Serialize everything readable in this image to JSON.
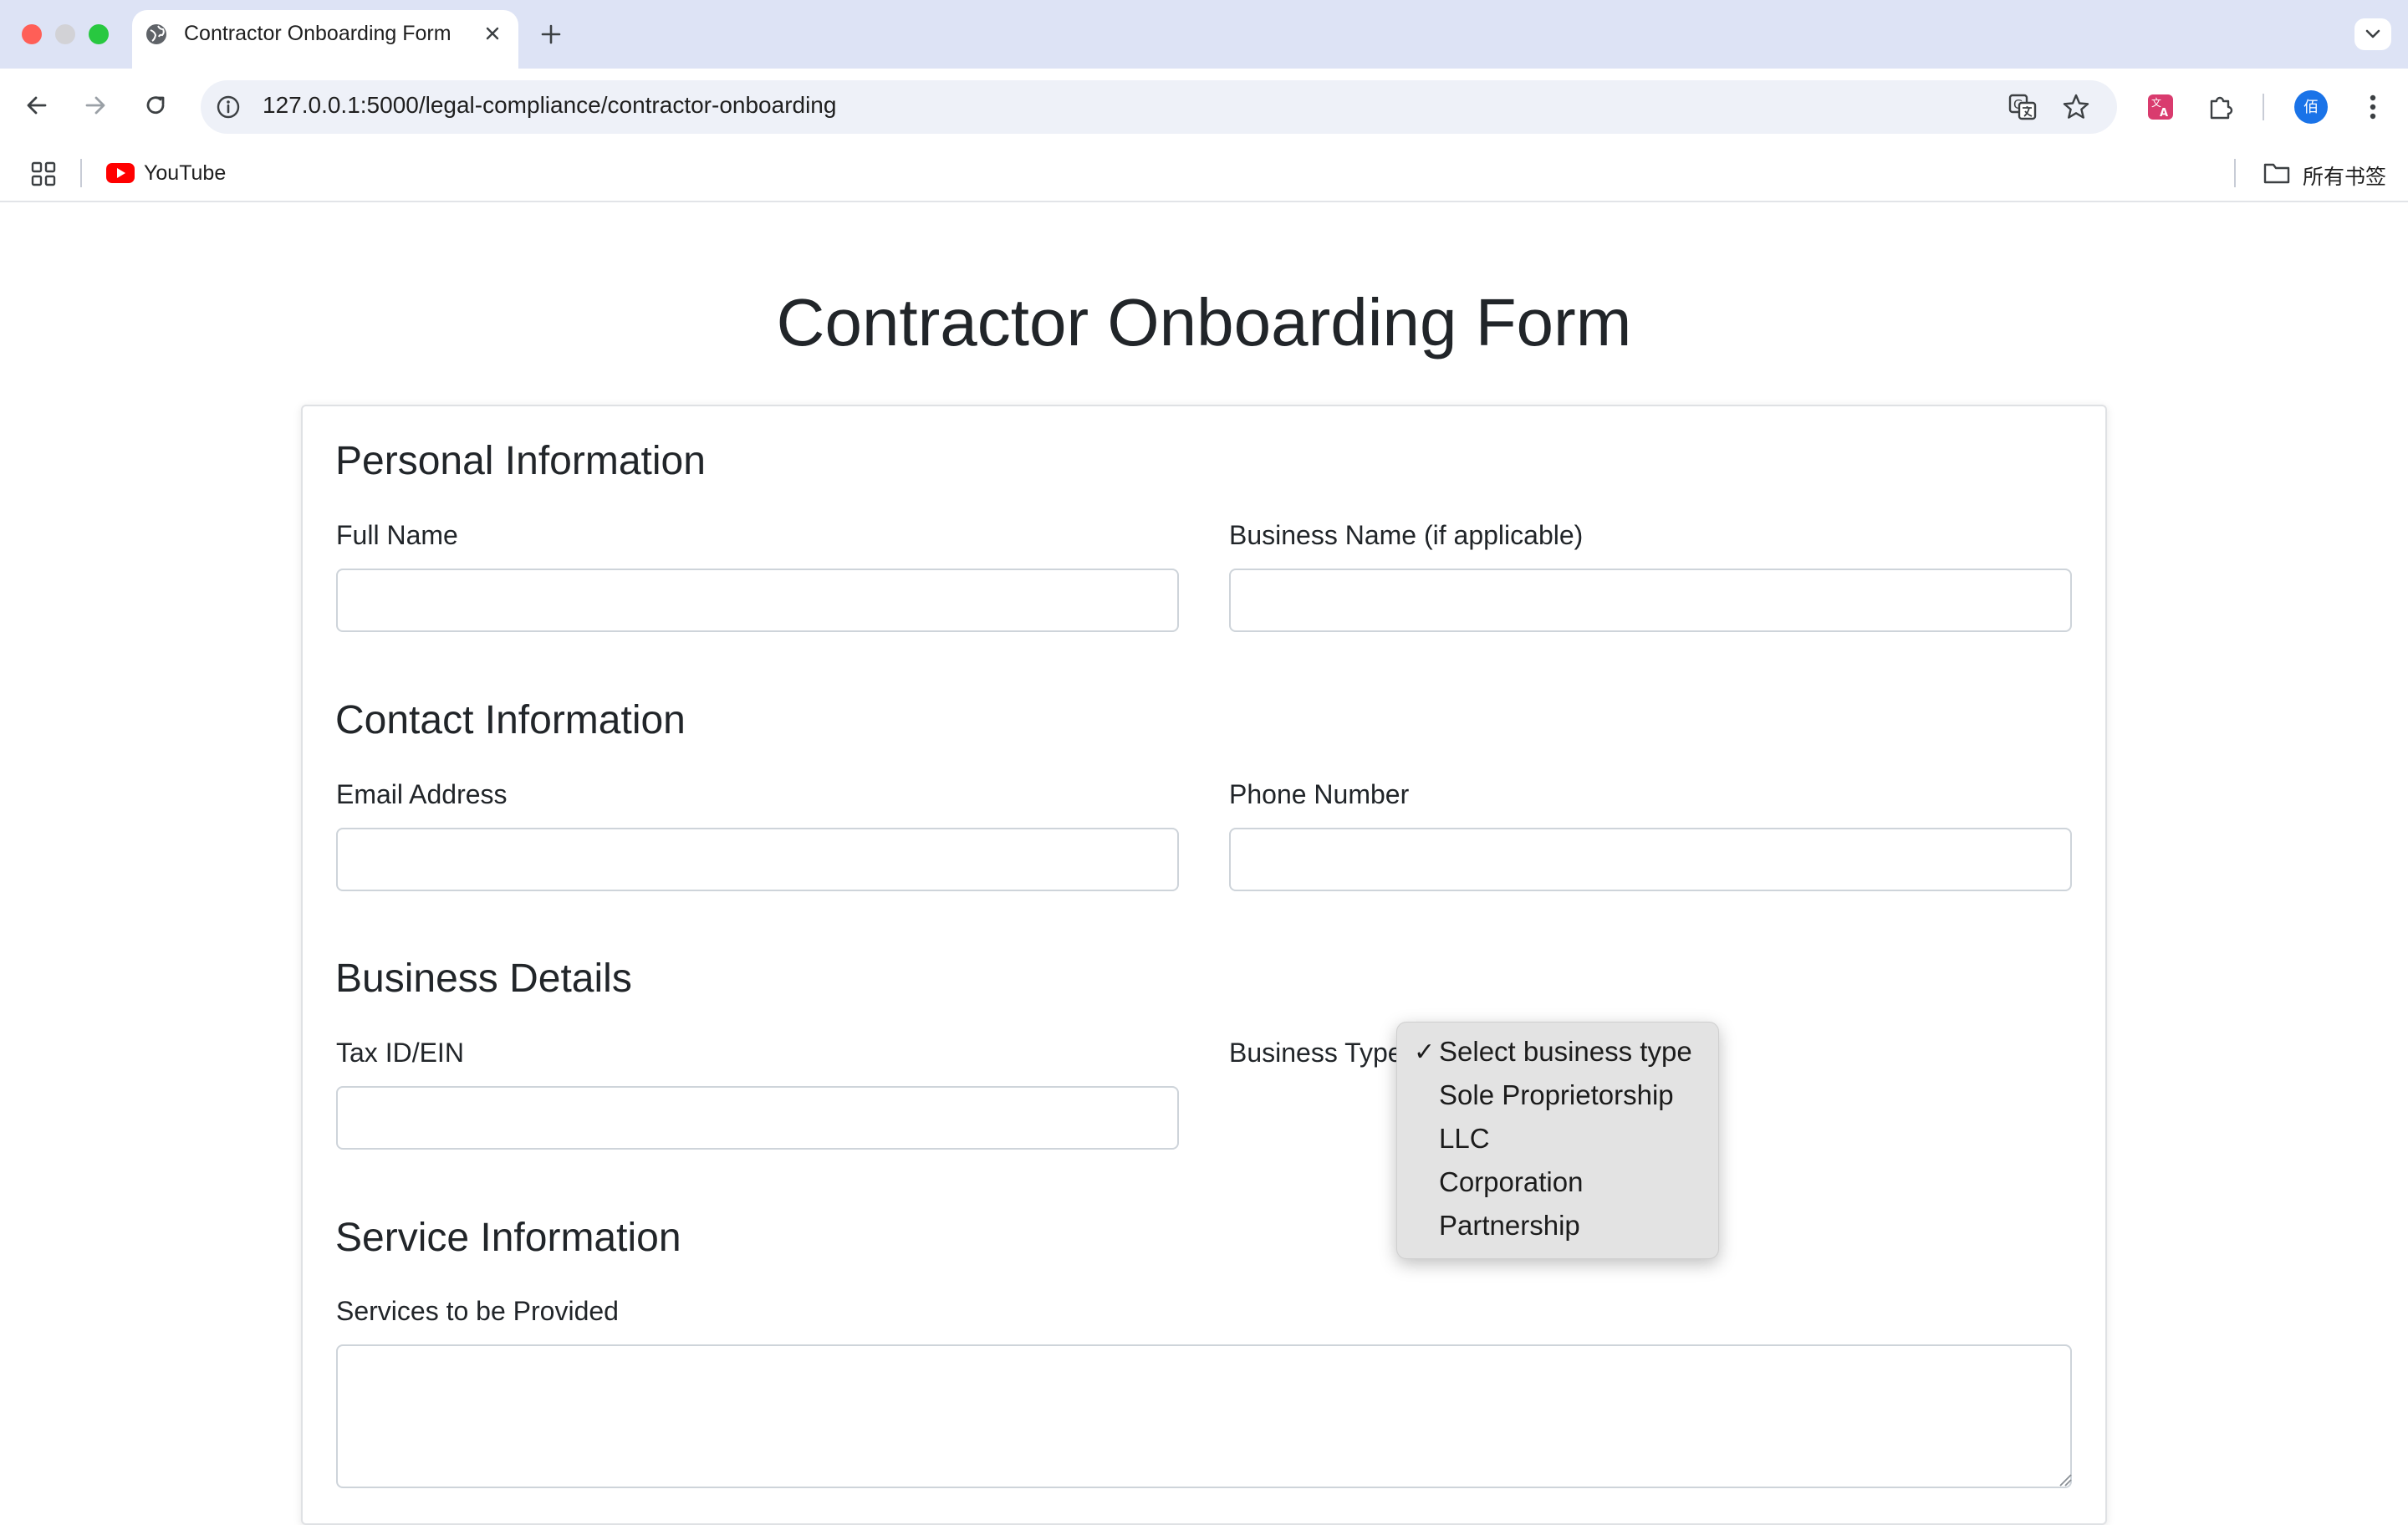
{
  "browser": {
    "tab_title": "Contractor Onboarding Form",
    "url": "127.0.0.1:5000/legal-compliance/contractor-onboarding",
    "avatar_initial": "佰",
    "bookmarks": [
      {
        "label": "YouTube",
        "icon": "youtube-icon"
      }
    ],
    "all_bookmarks_label": "所有书签"
  },
  "page": {
    "title": "Contractor Onboarding Form"
  },
  "sections": {
    "personal": {
      "heading": "Personal Information",
      "full_name_label": "Full Name",
      "full_name_value": "",
      "business_name_label": "Business Name (if applicable)",
      "business_name_value": ""
    },
    "contact": {
      "heading": "Contact Information",
      "email_label": "Email Address",
      "email_value": "",
      "phone_label": "Phone Number",
      "phone_value": ""
    },
    "business": {
      "heading": "Business Details",
      "tax_label": "Tax ID/EIN",
      "tax_value": "",
      "type_label": "Business Type",
      "type_options": [
        {
          "label": "Select business type",
          "selected": true
        },
        {
          "label": "Sole Proprietorship",
          "selected": false
        },
        {
          "label": "LLC",
          "selected": false
        },
        {
          "label": "Corporation",
          "selected": false
        },
        {
          "label": "Partnership",
          "selected": false
        }
      ],
      "check_mark": "✓"
    },
    "service": {
      "heading": "Service Information",
      "services_label": "Services to be Provided",
      "services_value": ""
    }
  },
  "colors": {
    "tabstrip": "#dde3f5",
    "omnibox": "#eef1f8",
    "dropdown_bg": "#e3e3e3",
    "input_border": "#ced4da"
  }
}
